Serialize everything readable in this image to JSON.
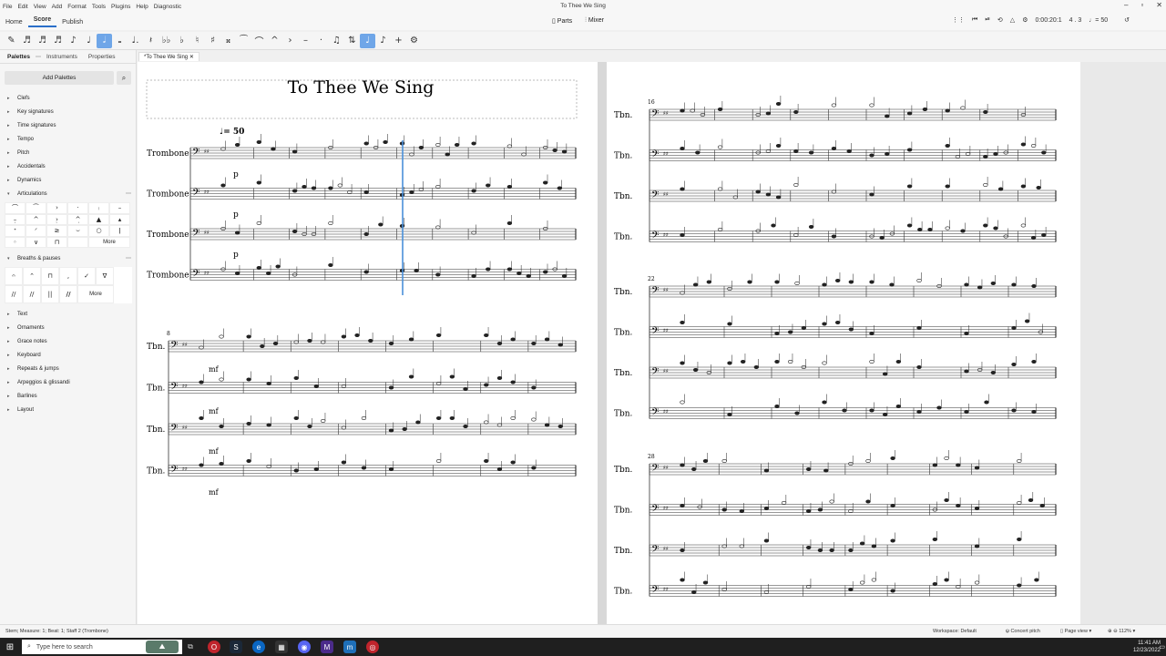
{
  "menubar": {
    "items": [
      "File",
      "Edit",
      "View",
      "Add",
      "Format",
      "Tools",
      "Plugins",
      "Help",
      "Diagnostic"
    ]
  },
  "window": {
    "title": "To Thee We Sing"
  },
  "tabs": [
    "Home",
    "Score",
    "Publish"
  ],
  "topcontrols": {
    "parts": "Parts",
    "mixer": "Mixer",
    "time": "0:00:20:1",
    "measure_beat": "4 . 3",
    "tempo": "♩= 50"
  },
  "palettes": {
    "tabs": [
      "Palettes",
      "Instruments",
      "Properties"
    ],
    "add_button": "Add Palettes",
    "items_top": [
      "Clefs",
      "Key signatures",
      "Time signatures",
      "Tempo",
      "Pitch",
      "Accidentals",
      "Dynamics"
    ],
    "articulations": "Articulations",
    "articulation_more": "More",
    "breaths": "Breaths & pauses",
    "breaths_more": "More",
    "items_bottom": [
      "Text",
      "Ornaments",
      "Grace notes",
      "Keyboard",
      "Repeats & jumps",
      "Arpeggios & glissandi",
      "Barlines",
      "Layout"
    ]
  },
  "document_tab": "*To Thee We Sing",
  "score": {
    "title": "To Thee We Sing",
    "tempo_mark": "♩= 50",
    "instrument_full": "Trombone",
    "instrument_short": "Tbn.",
    "dyn_p": "p",
    "dyn_mf": "mf",
    "measure_numbers": [
      "8",
      "16",
      "22",
      "28"
    ]
  },
  "statusbar": {
    "left": "Stem; Measure: 1; Beat: 1; Staff 2 (Trombone)",
    "workspace": "Workspace: Default",
    "concert": "Concert pitch",
    "view": "Page view",
    "zoom": "112%"
  },
  "taskbar": {
    "search_placeholder": "Type here to search",
    "time": "11:41 AM",
    "date": "12/23/2022"
  }
}
